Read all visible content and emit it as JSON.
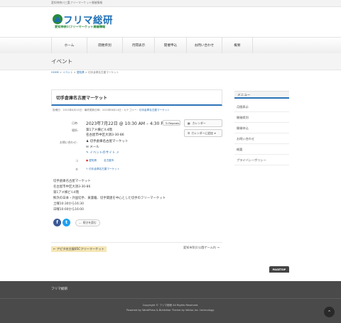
{
  "header": {
    "tagline": "愛知神奈川三重フリーマーケット開催情報",
    "logo_title": "フリマ総研",
    "logo_subtitle": "愛知神奈川フリーマーケット開催情報"
  },
  "nav": {
    "items": [
      {
        "label": "ホーム"
      },
      {
        "label": "開催県別"
      },
      {
        "label": "月間表示"
      },
      {
        "label": "開催申込"
      },
      {
        "label": "お問い合わせ"
      },
      {
        "label": "概要"
      }
    ]
  },
  "page_title": "イベント",
  "breadcrumb": {
    "home": "HOME",
    "sep": ">",
    "events": "イベント",
    "aichi": "愛知県",
    "current": "切手倉庫名古屋マーケット"
  },
  "event": {
    "title": "切手倉庫名古屋マーケット",
    "meta_prefix": "投稿日：2023年6月13日｜最終更新日時：2023年6月14日｜カテゴリー：",
    "meta_category": "切手倉庫名古屋マーケット",
    "labels": {
      "date": "日時:",
      "place": "場所:",
      "contact": "お問い合わせ:",
      "category": "コ",
      "tags": "タ"
    },
    "date_value": "2023年7月22日 @ 10:30 AM – 4:30 PM",
    "repeat_label": "Repeats",
    "calendar_label": "カレンダー",
    "calendar_add_label": "カレンダーに追加",
    "place_line1": "第1アメ横ビル4階",
    "place_line2": "名古屋市中区大須3-30-86",
    "contact_name": "切手倉庫名古屋マーケット",
    "contact_mail": "メール",
    "contact_site": "イベントのサイト",
    "categories": [
      "愛知県",
      "名古屋市"
    ],
    "tag": "切手倉庫名古屋マーケット",
    "body": [
      "切手倉庫名古屋マーケット",
      "名古屋市中区大須3-30-86",
      "第1アメ横ビル4階",
      "鮮浜の日本・外国切手、黄書籍、切手関連を中心とした切手のフリーマーケット",
      "土曜10:30から16:30",
      "日曜10:00から16:00"
    ],
    "share_button": "続きを読む",
    "prev_post": "← アピタ名古屋85Cフリーマーケット",
    "next_post": "愛知市防災公園ゲーム内 →"
  },
  "sidebar": {
    "heading": "メニュー",
    "items": [
      "月間表示",
      "開催県別",
      "開催申込",
      "お問い合わせ",
      "概要",
      "プライバシーポリシー"
    ]
  },
  "pagetop": "PAGETOP",
  "footer": {
    "site_name": "フリマ総研",
    "copyright": "Copyright © フリマ総研 All Rights Reserved.",
    "powered": "Powered by WordPress & BizVektor Theme by Vektor,Inc. technology."
  },
  "colors": {
    "accent": "#2b72b8",
    "logo_blue": "#1c6fb4",
    "logo_green": "#2a8a3b",
    "footer_bg": "#4a4a4a",
    "prev_highlight": "#f5e6b6"
  }
}
